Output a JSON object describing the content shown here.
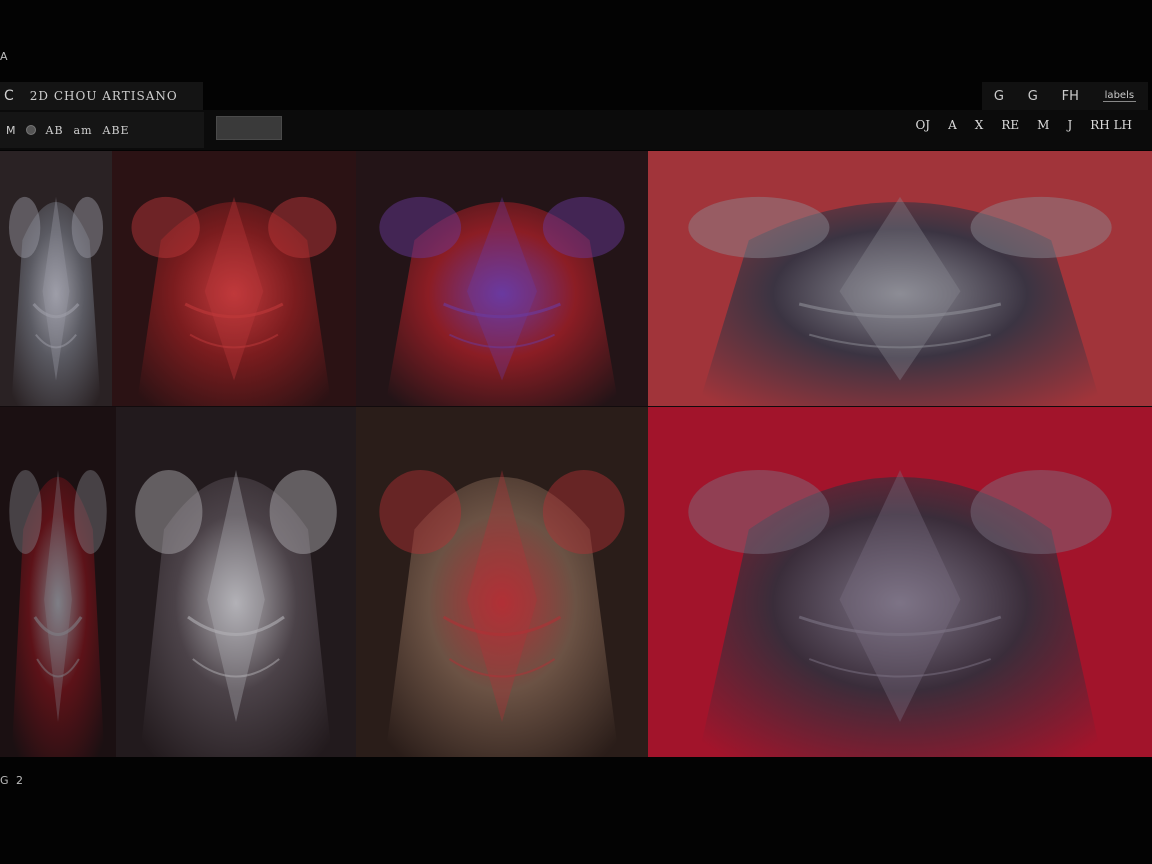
{
  "window": {
    "title": "A"
  },
  "tabbar": {
    "reload_icon": "reload-icon",
    "active_tab_title": "2D CHOU ARTISANO",
    "controls": [
      "G",
      "G",
      "FH",
      "labels"
    ]
  },
  "toolbar": {
    "left_items": [
      "M",
      "AB",
      "am",
      "ABE"
    ],
    "search": {
      "placeholder": ""
    },
    "right_items": [
      "OJ",
      "A",
      "X",
      "RE",
      "M",
      "J",
      "RH LH"
    ]
  },
  "gallery": {
    "rows": 2,
    "tiles": [
      {
        "name": "armor-tile-1",
        "palette": [
          "#5a5a62",
          "#2a2224",
          "#9e9ea8"
        ]
      },
      {
        "name": "armor-tile-2",
        "palette": [
          "#7a1c1e",
          "#2b1214",
          "#c0393b"
        ]
      },
      {
        "name": "armor-tile-3",
        "palette": [
          "#8b1d24",
          "#231417",
          "#6a3aa0"
        ]
      },
      {
        "name": "armor-tile-4",
        "palette": [
          "#3b3442",
          "#a1343a",
          "#8d8d96"
        ]
      },
      {
        "name": "armor-tile-5",
        "palette": [
          "#5c1218",
          "#1b1012",
          "#7f7f86"
        ]
      },
      {
        "name": "armor-tile-6",
        "palette": [
          "#4b4248",
          "#221a1d",
          "#b3b1b6"
        ]
      },
      {
        "name": "armor-tile-7",
        "palette": [
          "#6b5244",
          "#2a1d19",
          "#b13036"
        ]
      },
      {
        "name": "armor-tile-8",
        "palette": [
          "#3a2d3a",
          "#a2142b",
          "#7d7486"
        ]
      }
    ]
  },
  "status": {
    "text": "G 2"
  }
}
